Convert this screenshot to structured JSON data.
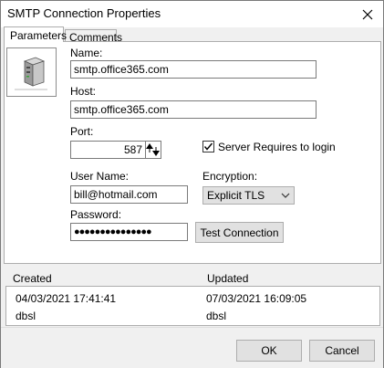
{
  "window": {
    "title": "SMTP Connection Properties"
  },
  "tabs": [
    {
      "label": "Parameters",
      "active": true
    },
    {
      "label": "Comments",
      "active": false
    }
  ],
  "form": {
    "name_label": "Name:",
    "name_value": "smtp.office365.com",
    "host_label": "Host:",
    "host_value": "smtp.office365.com",
    "port_label": "Port:",
    "port_value": "587",
    "login_label": "Server Requires to login",
    "login_checked": true,
    "username_label": "User Name:",
    "username_value": "bill@hotmail.com",
    "encryption_label": "Encryption:",
    "encryption_value": "Explicit TLS",
    "password_label": "Password:",
    "password_mask": "●●●●●●●●●●●●●●●",
    "test_button": "Test Connection"
  },
  "info": {
    "created_label": "Created",
    "updated_label": "Updated",
    "created_date": "04/03/2021 17:41:41",
    "updated_date": "07/03/2021 16:09:05",
    "created_by": "dbsl",
    "updated_by": "dbsl"
  },
  "footer": {
    "ok_label": "OK",
    "cancel_label": "Cancel"
  },
  "icons": {
    "server": "server-icon",
    "close": "close-icon"
  }
}
